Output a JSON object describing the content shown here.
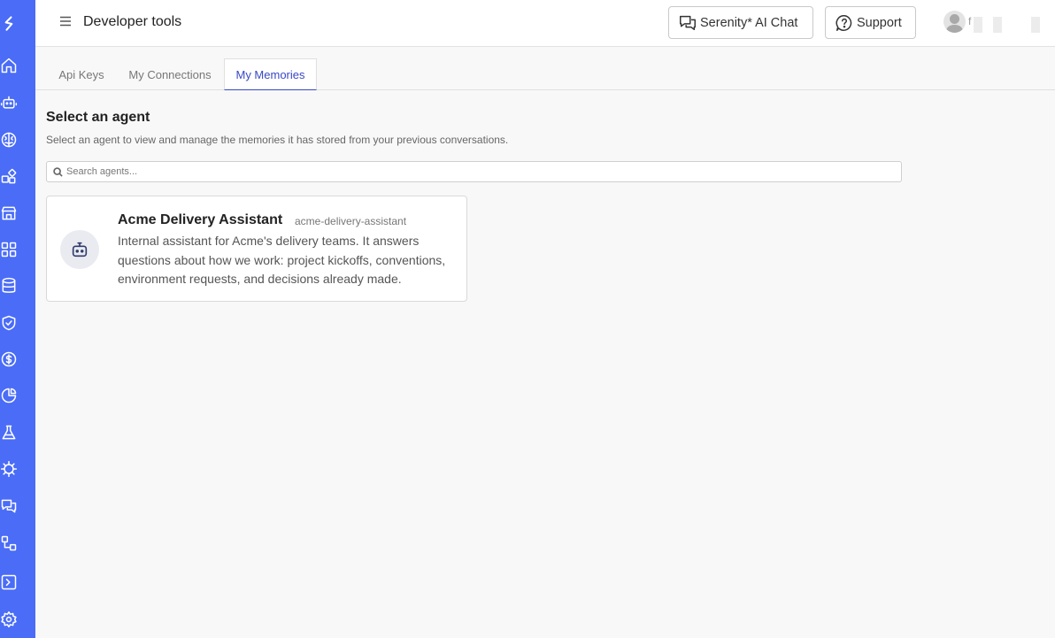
{
  "sidebar": {
    "icons": [
      "logo-icon",
      "home-icon",
      "robot-icon",
      "brain-icon",
      "shapes-icon",
      "store-icon",
      "apps-grid-icon",
      "database-icon",
      "shield-check-icon",
      "dollar-circle-icon",
      "pie-chart-icon",
      "flask-icon",
      "virus-icon",
      "chat-icon",
      "workflow-icon",
      "terminal-icon",
      "gear-icon"
    ]
  },
  "header": {
    "title": "Developer tools",
    "chat_button": "Serenity* AI Chat",
    "support_button": "Support",
    "user_initial": "f"
  },
  "tabs": [
    {
      "label": "Api Keys",
      "active": false
    },
    {
      "label": "My Connections",
      "active": false
    },
    {
      "label": "My Memories",
      "active": true
    }
  ],
  "main": {
    "title": "Select an agent",
    "description": "Select an agent to view and manage the memories it has stored from your previous conversations.",
    "search_placeholder": "Search agents..."
  },
  "agents": [
    {
      "name": "Acme Delivery Assistant",
      "slug": "acme-delivery-assistant",
      "description": "Internal assistant for Acme's delivery teams. It answers questions about how we work: project kickoffs, conventions, environment requests, and decisions already made."
    }
  ],
  "colors": {
    "sidebar": "#4a6cf7",
    "accent": "#3849c4"
  }
}
